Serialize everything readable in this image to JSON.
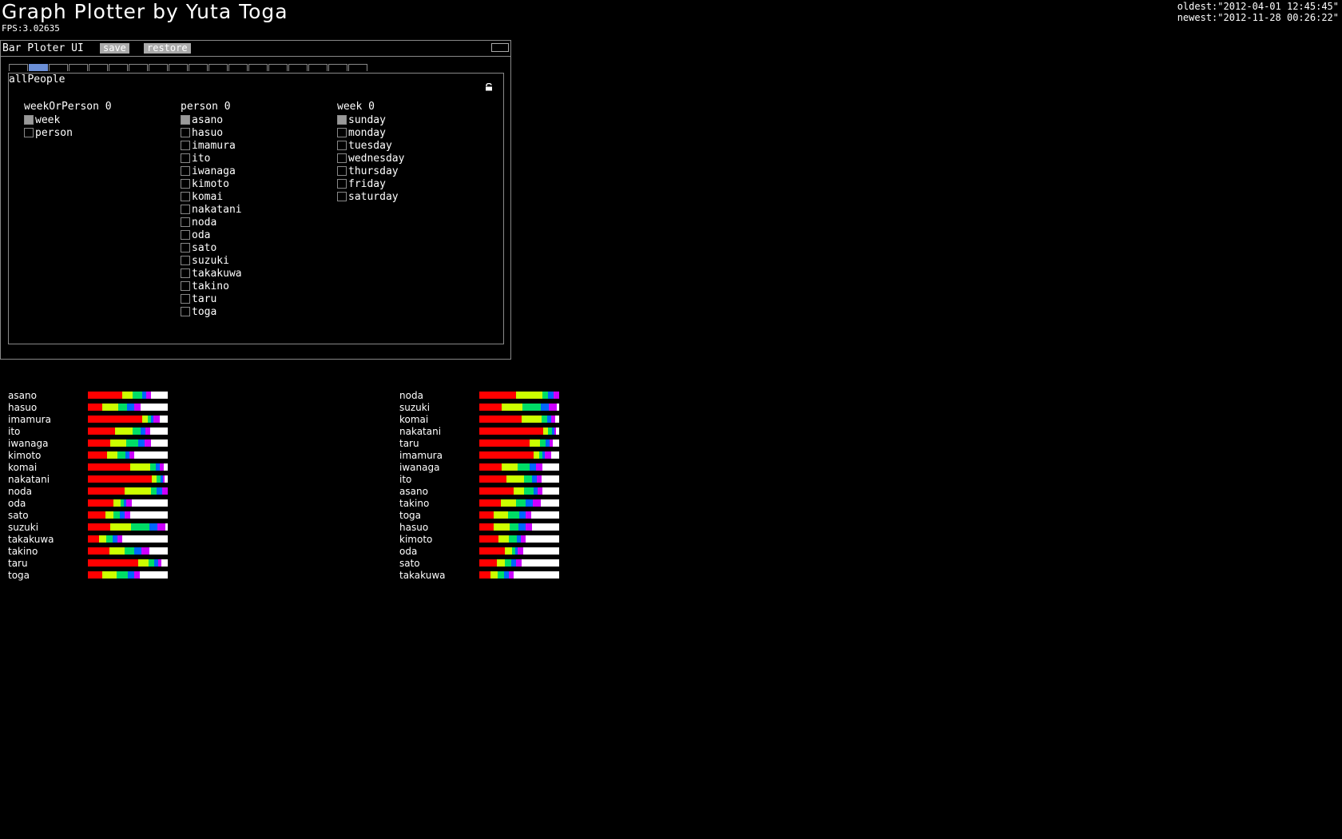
{
  "header": {
    "title": "Graph Plotter by Yuta Toga",
    "fps": "FPS:3.02635",
    "oldest": "oldest:\"2012-04-01 12:45:45\"",
    "newest": "newest:\"2012-11-28 00:26:22\""
  },
  "panel": {
    "title": "Bar Ploter UI",
    "save_label": "save",
    "restore_label": "restore",
    "tab_count": 18,
    "active_tab": 1,
    "section_label": "allPeople",
    "groups": [
      {
        "title": "weekOrPerson 0",
        "options": [
          "week",
          "person"
        ],
        "checked": [
          true,
          false
        ]
      },
      {
        "title": "person 0",
        "options": [
          "asano",
          "hasuo",
          "imamura",
          "ito",
          "iwanaga",
          "kimoto",
          "komai",
          "nakatani",
          "noda",
          "oda",
          "sato",
          "suzuki",
          "takakuwa",
          "takino",
          "taru",
          "toga"
        ],
        "checked": [
          true,
          false,
          false,
          false,
          false,
          false,
          false,
          false,
          false,
          false,
          false,
          false,
          false,
          false,
          false,
          false
        ]
      },
      {
        "title": "week 0",
        "options": [
          "sunday",
          "monday",
          "tuesday",
          "wednesday",
          "thursday",
          "friday",
          "saturday"
        ],
        "checked": [
          true,
          false,
          false,
          false,
          false,
          false,
          false
        ]
      }
    ]
  },
  "colors": {
    "segments": [
      "#ff0000",
      "#ccff00",
      "#00dd66",
      "#0066ff",
      "#cc00ff",
      "#ffffff"
    ]
  },
  "chart_data": [
    {
      "type": "bar",
      "stacked": true,
      "categories": [
        "asano",
        "hasuo",
        "imamura",
        "ito",
        "iwanaga",
        "kimoto",
        "komai",
        "nakatani",
        "noda",
        "oda",
        "sato",
        "suzuki",
        "takakuwa",
        "takino",
        "taru",
        "toga"
      ],
      "values": [
        [
          0.43,
          0.13,
          0.12,
          0.05,
          0.06,
          0.21
        ],
        [
          0.18,
          0.2,
          0.11,
          0.09,
          0.08,
          0.34
        ],
        [
          0.68,
          0.07,
          0.04,
          0.03,
          0.08,
          0.1
        ],
        [
          0.34,
          0.22,
          0.1,
          0.06,
          0.06,
          0.22
        ],
        [
          0.28,
          0.2,
          0.15,
          0.08,
          0.08,
          0.21
        ],
        [
          0.24,
          0.13,
          0.1,
          0.05,
          0.06,
          0.42
        ],
        [
          0.53,
          0.25,
          0.07,
          0.05,
          0.05,
          0.05
        ],
        [
          0.8,
          0.06,
          0.05,
          0.03,
          0.02,
          0.04
        ],
        [
          0.46,
          0.33,
          0.07,
          0.07,
          0.07,
          0.0
        ],
        [
          0.32,
          0.09,
          0.04,
          0.03,
          0.07,
          0.45
        ],
        [
          0.22,
          0.1,
          0.08,
          0.06,
          0.07,
          0.47
        ],
        [
          0.28,
          0.26,
          0.23,
          0.1,
          0.1,
          0.03
        ],
        [
          0.14,
          0.09,
          0.08,
          0.06,
          0.06,
          0.57
        ],
        [
          0.27,
          0.19,
          0.12,
          0.09,
          0.1,
          0.23
        ],
        [
          0.63,
          0.13,
          0.07,
          0.05,
          0.04,
          0.08
        ],
        [
          0.18,
          0.18,
          0.14,
          0.08,
          0.07,
          0.35
        ]
      ]
    },
    {
      "type": "bar",
      "stacked": true,
      "categories": [
        "noda",
        "suzuki",
        "komai",
        "nakatani",
        "taru",
        "imamura",
        "iwanaga",
        "ito",
        "asano",
        "takino",
        "toga",
        "hasuo",
        "kimoto",
        "oda",
        "sato",
        "takakuwa"
      ],
      "values": [
        [
          0.46,
          0.33,
          0.07,
          0.07,
          0.07,
          0.0
        ],
        [
          0.28,
          0.26,
          0.23,
          0.1,
          0.1,
          0.03
        ],
        [
          0.53,
          0.25,
          0.07,
          0.05,
          0.05,
          0.05
        ],
        [
          0.8,
          0.06,
          0.05,
          0.03,
          0.02,
          0.04
        ],
        [
          0.63,
          0.13,
          0.07,
          0.05,
          0.04,
          0.08
        ],
        [
          0.68,
          0.07,
          0.04,
          0.03,
          0.08,
          0.1
        ],
        [
          0.28,
          0.2,
          0.15,
          0.08,
          0.08,
          0.21
        ],
        [
          0.34,
          0.22,
          0.1,
          0.06,
          0.06,
          0.22
        ],
        [
          0.43,
          0.13,
          0.12,
          0.05,
          0.06,
          0.21
        ],
        [
          0.27,
          0.19,
          0.12,
          0.09,
          0.1,
          0.23
        ],
        [
          0.18,
          0.18,
          0.14,
          0.08,
          0.07,
          0.35
        ],
        [
          0.18,
          0.2,
          0.11,
          0.09,
          0.08,
          0.34
        ],
        [
          0.24,
          0.13,
          0.1,
          0.05,
          0.06,
          0.42
        ],
        [
          0.32,
          0.09,
          0.04,
          0.03,
          0.07,
          0.45
        ],
        [
          0.22,
          0.1,
          0.08,
          0.06,
          0.07,
          0.47
        ],
        [
          0.14,
          0.09,
          0.08,
          0.06,
          0.06,
          0.57
        ]
      ]
    }
  ]
}
